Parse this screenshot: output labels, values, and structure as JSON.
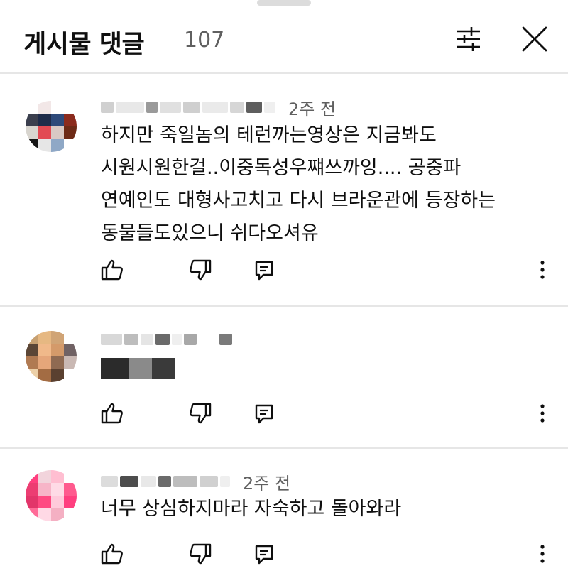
{
  "header": {
    "title": "게시물 댓글",
    "count": "107"
  },
  "icons": {
    "filter": "tune-icon",
    "close": "close-icon",
    "like": "thumb-up-icon",
    "dislike": "thumb-down-icon",
    "reply": "reply-icon",
    "more": "more-vert-icon"
  },
  "comments": [
    {
      "time": "2주 전",
      "text": "하지만 죽일놈의 테런까는영상은 지금봐도\n시원시원한걸..이중독성우쨰쓰까잉.... 공중파\n연예인도 대형사고치고 다시 브라운관에 등장하는\n동물들도있으니 쉬다오셔유"
    },
    {
      "time": "",
      "text": ""
    },
    {
      "time": "2주 전",
      "text": "너무 상심하지마라 자숙하고 돌아와라"
    }
  ]
}
